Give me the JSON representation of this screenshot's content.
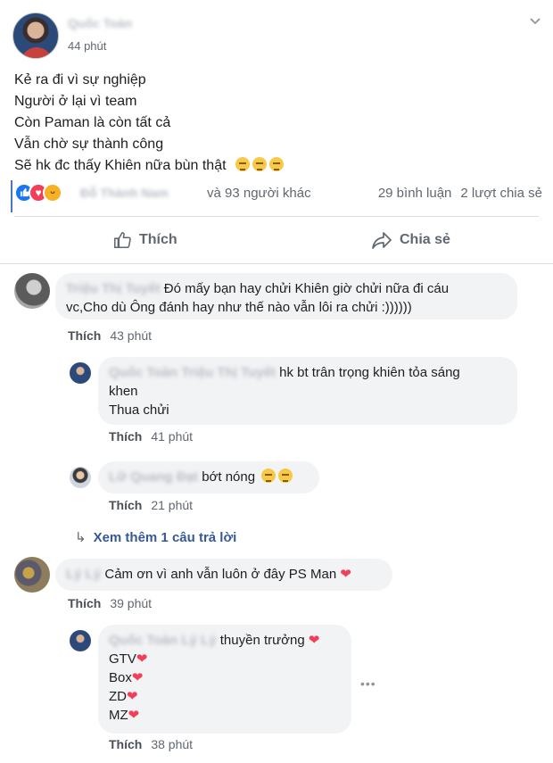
{
  "post": {
    "author_name": "Quốc Toàn",
    "timestamp": "44 phút",
    "lines": [
      "Kẻ ra đi vì sự nghiệp",
      "Người ở lại vì team",
      "Còn Paman là còn tất cả",
      "Vẫn chờ sự thành công",
      "Sẽ hk đc thấy Khiên nữa bùn thật"
    ],
    "emoji_name": "disappointed-face-emoji",
    "reactions": {
      "icons": [
        "like-icon",
        "love-icon",
        "haha-icon"
      ],
      "first_reactor": "Đỗ Thành Nam",
      "others": "và 93 người khác",
      "comments": "29 bình luận",
      "shares": "2 lượt chia sẻ"
    },
    "actions": {
      "like": "Thích",
      "share": "Chia sẻ"
    }
  },
  "comments": [
    {
      "name": "Triệu Thị Tuyết",
      "text1": "Đó mấy bạn hay chửi Khiên giờ chửi nữa đi cáu",
      "text2": "vc,Cho dù Ông đánh hay như thế nào vẫn lôi ra chửi :))))))",
      "like": "Thích",
      "time": "43 phút",
      "replies": [
        {
          "name": "Quốc Toàn Triệu Thị Tuyết",
          "text1": "hk bt trân trọng khiên tỏa sáng",
          "text2": "khen",
          "text3": "Thua chửi",
          "like": "Thích",
          "time": "41 phút"
        },
        {
          "name": "Lữ Quang Đạt",
          "text1": "bớt nóng",
          "like": "Thích",
          "time": "21 phút"
        }
      ],
      "more_replies": "Xem thêm 1 câu trả lời"
    },
    {
      "name": "Lý Lý",
      "text1": "Cảm ơn vì anh vẫn luôn ở đây PS Man",
      "like": "Thích",
      "time": "39 phút",
      "replies": [
        {
          "name": "Quốc Toàn Lý Lý",
          "text1": "thuyền trưởng",
          "items": [
            "GTV",
            "Box",
            "ZD",
            "MZ"
          ],
          "like": "Thích",
          "time": "38 phút"
        }
      ]
    }
  ],
  "colors": {
    "link": "#365899",
    "like_blue": "#1877f2",
    "love_red": "#f33e58",
    "haha_yellow": "#f7b125",
    "bubble": "#f2f3f5"
  }
}
